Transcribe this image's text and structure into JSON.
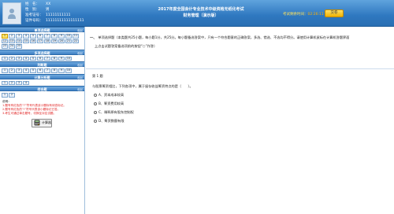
{
  "header": {
    "title_line1": "2017年度全国会计专业技术中级资格无纸化考试",
    "title_line2": "财务管理（演示版）",
    "candidate": {
      "name_label": "姓　名：",
      "name_value": "XX",
      "gender_label": "性　别：",
      "gender_value": "男",
      "exam_no_label": "准考证号：",
      "exam_no_value": "11111111111",
      "id_label": "证件号码：",
      "id_value": "11111111111111111"
    },
    "timer_label": "考试剩余时间：",
    "timer_value": "02:26:11",
    "submit_label": "交卷"
  },
  "sidebar": {
    "sections": [
      {
        "title": "单项选择题",
        "flag": "收起",
        "cells": [
          "1",
          "2",
          "3",
          "4",
          "5",
          "6",
          "7",
          "8",
          "9",
          "10",
          "11",
          "12",
          "13",
          "14",
          "15",
          "16",
          "17",
          "18",
          "19",
          "20",
          "21",
          "22",
          "23",
          "24",
          "25"
        ]
      },
      {
        "title": "多项选择题",
        "flag": "收起",
        "cells": [
          "1",
          "2",
          "3",
          "4",
          "5",
          "6",
          "7",
          "8",
          "9",
          "10"
        ]
      },
      {
        "title": "判断题",
        "flag": "收起",
        "cells": [
          "1",
          "2",
          "3",
          "4",
          "5",
          "6",
          "7",
          "8",
          "9",
          "10"
        ]
      },
      {
        "title": "计算分析题",
        "flag": "收起",
        "cells": [
          "1",
          "2",
          "3",
          "4"
        ]
      },
      {
        "title": "综合题",
        "flag": "收起",
        "cells": [
          "1",
          "2"
        ]
      }
    ],
    "notes": {
      "title": "说明：",
      "line1": "1.题号有红色的“?”符号代表该小题标有待查标记。",
      "line2": "2.题号有红色的“!”符号代表该小题标记已答。",
      "line3": "3.考生可通过单击题号，切换至对应试题。"
    },
    "calculator_label": "计算器"
  },
  "main": {
    "section_no": "一、",
    "rules_line1": "单项选择题（本类题共25小题，每小题1分，共25分。每小题备选答案中，只有一个符合题意的正确答案，多选、错选、不选均不得分。请使用计算机鼠标在计算机答题界面",
    "rules_line2": "上点击试题答案备选项前的按钮“○”作答）",
    "question_number": "第 1 题",
    "question_stem": "与股票筹资相比，下列各项中，属于留存收益筹资特点的是（　　）。",
    "options": [
      {
        "label": "A、资本成本较高"
      },
      {
        "label": "B、筹资费用较高"
      },
      {
        "label": "C、稀释原有股东控制权"
      },
      {
        "label": "D、筹资数额有限"
      }
    ]
  },
  "colors": {
    "header_blue": "#2f78c0",
    "section_bar": "#3e80c4",
    "timer_text": "#ffe25b",
    "submit_button": "#f2b300",
    "notes_red": "#e02020"
  }
}
